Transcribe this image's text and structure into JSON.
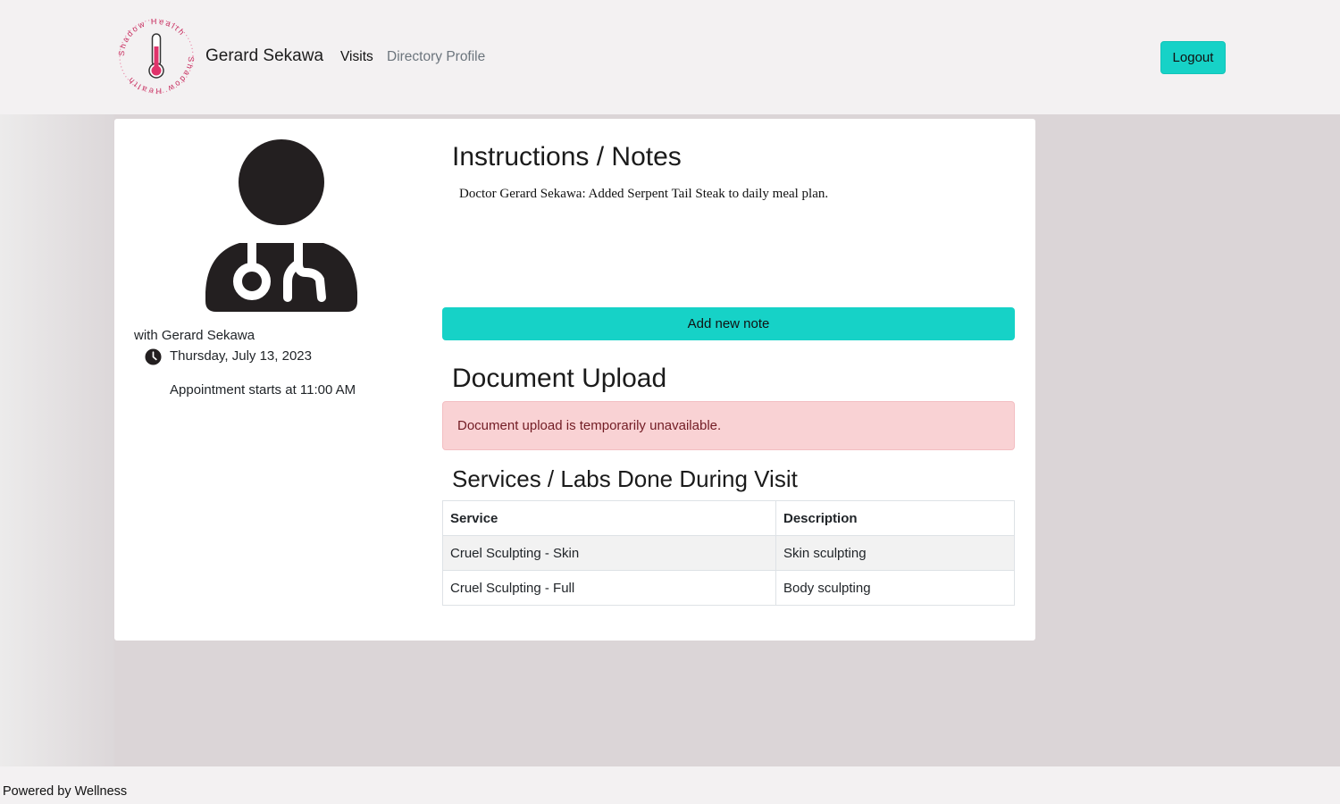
{
  "header": {
    "logo_text": "Shadow Health",
    "user_name": "Gerard Sekawa",
    "nav": [
      {
        "label": "Visits"
      },
      {
        "label": "Directory Profile"
      }
    ],
    "logout_label": "Logout"
  },
  "visit": {
    "with_label": "with Gerard Sekawa",
    "date": "Thursday, July 13, 2023",
    "appointment_start": "Appointment starts at 11:00 AM"
  },
  "notes": {
    "heading": "Instructions / Notes",
    "text": "Doctor Gerard Sekawa: Added Serpent Tail Steak to daily meal plan.",
    "add_button_label": "Add new note"
  },
  "upload": {
    "heading": "Document Upload",
    "alert_text": "Document upload is temporarily unavailable."
  },
  "services": {
    "heading": "Services / Labs Done During Visit",
    "columns": [
      "Service",
      "Description"
    ],
    "rows": [
      [
        "Cruel Sculpting - Skin",
        "Skin sculpting"
      ],
      [
        "Cruel Sculpting - Full",
        "Body sculpting"
      ]
    ]
  },
  "footer": {
    "text": "Powered by Wellness"
  },
  "colors": {
    "accent": "#16d2c7",
    "logo_pink": "#d6336c",
    "alert_bg": "#f9d2d4",
    "alert_text": "#721c24"
  },
  "icons": [
    "thermometer-logo-icon",
    "doctor-avatar-icon",
    "clock-icon"
  ]
}
